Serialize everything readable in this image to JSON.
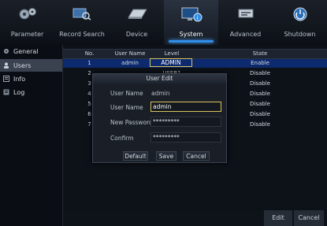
{
  "nav": {
    "items": [
      {
        "label": "Parameter",
        "icon": "gears-icon"
      },
      {
        "label": "Record Search",
        "icon": "record-search-icon"
      },
      {
        "label": "Device",
        "icon": "device-disk-icon"
      },
      {
        "label": "System",
        "icon": "system-monitor-icon"
      },
      {
        "label": "Advanced",
        "icon": "advanced-icon"
      },
      {
        "label": "Shutdown",
        "icon": "shutdown-icon"
      }
    ],
    "active": "System"
  },
  "sidebar": {
    "items": [
      {
        "label": "General",
        "icon": "gear-icon"
      },
      {
        "label": "Users",
        "icon": "user-icon"
      },
      {
        "label": "Info",
        "icon": "info-icon"
      },
      {
        "label": "Log",
        "icon": "log-icon"
      }
    ],
    "active": "Users"
  },
  "table": {
    "headers": {
      "no": "No.",
      "username": "User Name",
      "level": "Level",
      "state": "State"
    },
    "rows": [
      {
        "no": "1",
        "username": "admin",
        "level": "ADMIN",
        "state": "Enable"
      },
      {
        "no": "2",
        "username": "",
        "level": "USER1",
        "state": "Disable"
      },
      {
        "no": "3",
        "username": "",
        "level": "",
        "state": "Disable"
      },
      {
        "no": "4",
        "username": "",
        "level": "",
        "state": "Disable"
      },
      {
        "no": "5",
        "username": "",
        "level": "",
        "state": "Disable"
      },
      {
        "no": "6",
        "username": "",
        "level": "",
        "state": "Disable"
      },
      {
        "no": "7",
        "username": "",
        "level": "",
        "state": "Disable"
      }
    ]
  },
  "dialog": {
    "title": "User Edit",
    "username_label": "User Name",
    "username_value": "admin",
    "username2_label": "User Name",
    "username2_value": "admin",
    "password_label": "New Password",
    "password_value": "*********",
    "confirm_label": "Confirm",
    "confirm_value": "*********",
    "default_label": "Default",
    "save_label": "Save",
    "cancel_label": "Cancel"
  },
  "footer": {
    "edit_label": "Edit",
    "cancel_label": "Cancel"
  },
  "colors": {
    "accent": "#2f8ee8",
    "selected_row": "#0d2a6e",
    "focus_border": "#d9c35a"
  }
}
